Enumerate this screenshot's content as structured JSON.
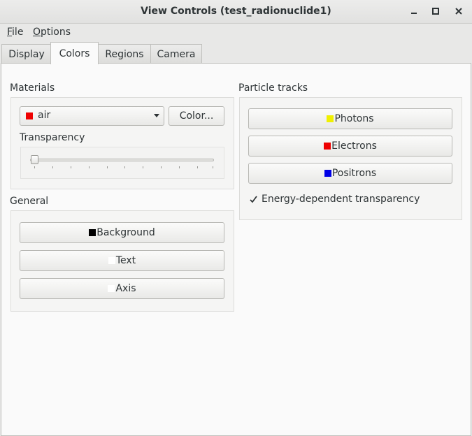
{
  "window": {
    "title": "View Controls (test_radionuclide1)"
  },
  "menubar": {
    "items": [
      {
        "label": "File",
        "mnemonic": "F",
        "rest": "ile"
      },
      {
        "label": "Options",
        "mnemonic": "O",
        "rest": "ptions"
      }
    ]
  },
  "tabs": [
    {
      "label": "Display",
      "active": false
    },
    {
      "label": "Colors",
      "active": true
    },
    {
      "label": "Regions",
      "active": false
    },
    {
      "label": "Camera",
      "active": false
    }
  ],
  "materials": {
    "section_label": "Materials",
    "selected_material": "air",
    "selected_color": "#ee0000",
    "color_button_label": "Color...",
    "transparency_label": "Transparency",
    "transparency_value": 0
  },
  "general": {
    "section_label": "General",
    "background_label": "Background",
    "background_color": "#000000",
    "text_label": "Text",
    "text_color": "#ffffff",
    "axis_label": "Axis",
    "axis_color": "#ffffff"
  },
  "particle_tracks": {
    "section_label": "Particle tracks",
    "photons_label": "Photons",
    "photons_color": "#f0f000",
    "electrons_label": "Electrons",
    "electrons_color": "#ee0000",
    "positrons_label": "Positrons",
    "positrons_color": "#0000e6",
    "energy_transparency_label": "Energy-dependent transparency",
    "energy_transparency_checked": true
  }
}
